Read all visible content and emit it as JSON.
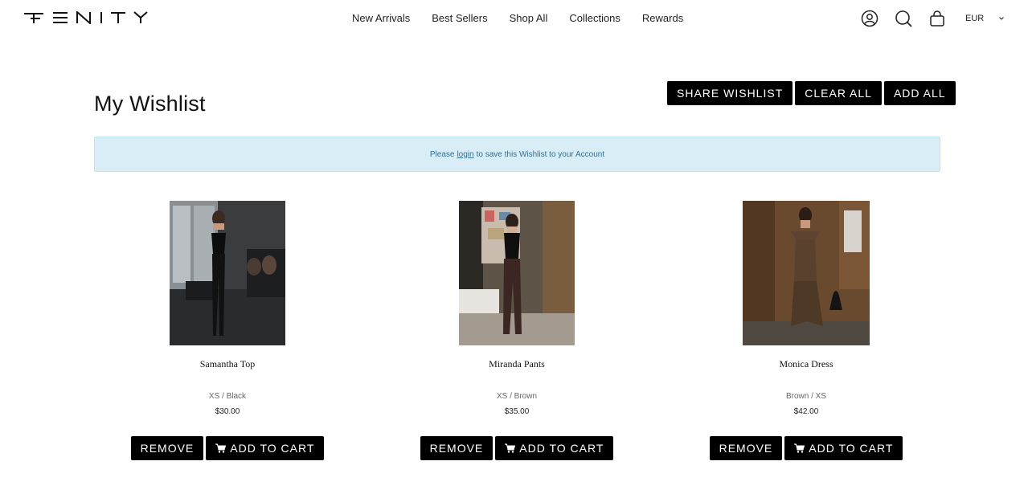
{
  "brand": {
    "logo_icon": "fenity-wordmark-logo"
  },
  "nav": {
    "items": [
      {
        "label": "New Arrivals"
      },
      {
        "label": "Best Sellers"
      },
      {
        "label": "Shop All"
      },
      {
        "label": "Collections"
      },
      {
        "label": "Rewards"
      }
    ]
  },
  "header_icons": [
    "account-icon",
    "search-icon",
    "cart-bag-icon"
  ],
  "currency": {
    "value": "EUR",
    "icon": "chevron-down-icon"
  },
  "wishlist": {
    "title": "My Wishlist",
    "share_label": "Share Wishlist",
    "clear_label": "Clear All",
    "add_all_label": "Add All",
    "notice": {
      "before": "Please",
      "link": "login",
      "after": "to save this Wishlist to your Account"
    }
  },
  "products": [
    {
      "name": "Samantha Top",
      "variant": "XS / Black",
      "price": "$30.00",
      "remove_label": "Remove",
      "add_label": "Add to Cart"
    },
    {
      "name": "Miranda Pants",
      "variant": "XS / Brown",
      "price": "$35.00",
      "remove_label": "Remove",
      "add_label": "Add to Cart"
    },
    {
      "name": "Monica Dress",
      "variant": "Brown / XS",
      "price": "$42.00",
      "remove_label": "Remove",
      "add_label": "Add to Cart"
    }
  ],
  "colors": {
    "button_bg": "#000000",
    "notice_bg": "#d9edf7",
    "notice_text": "#31708f"
  }
}
